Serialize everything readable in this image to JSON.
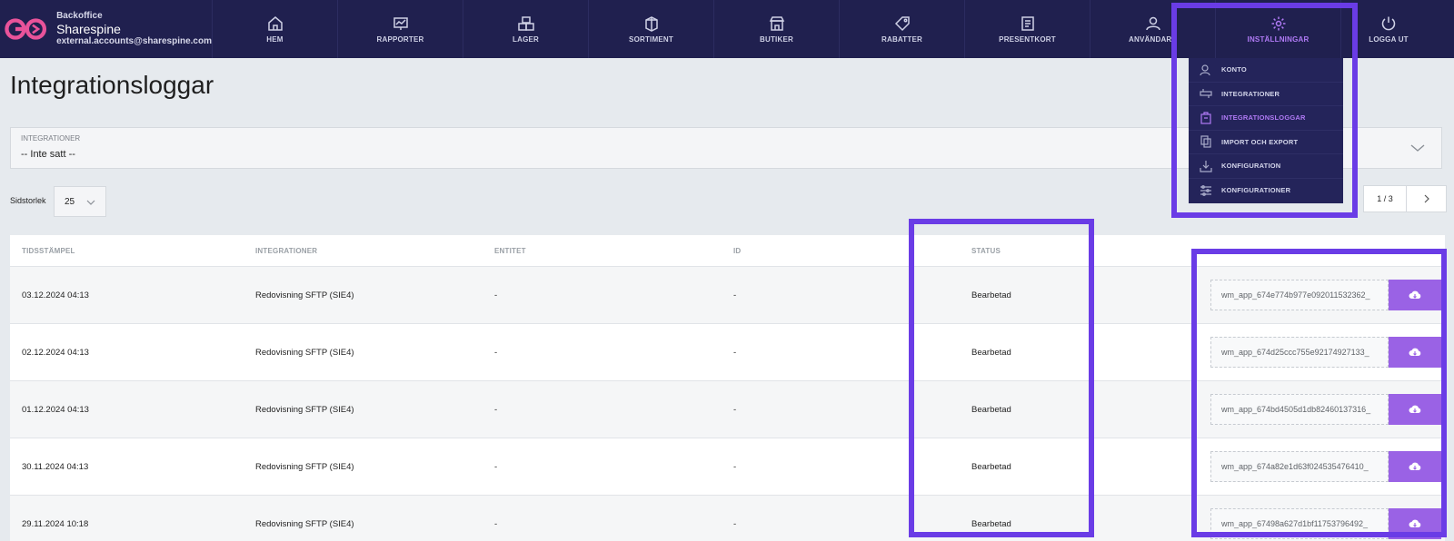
{
  "brand": {
    "small": "Backoffice",
    "name": "Sharespine",
    "email": "external.accounts@sharespine.com"
  },
  "nav": [
    {
      "label": "HEM",
      "icon": "home-icon"
    },
    {
      "label": "RAPPORTER",
      "icon": "chart-icon"
    },
    {
      "label": "LAGER",
      "icon": "boxes-icon"
    },
    {
      "label": "SORTIMENT",
      "icon": "package-icon"
    },
    {
      "label": "BUTIKER",
      "icon": "store-icon"
    },
    {
      "label": "RABATTER",
      "icon": "tag-icon"
    },
    {
      "label": "PRESENTKORT",
      "icon": "giftcard-icon"
    },
    {
      "label": "ANVÄNDARE",
      "icon": "users-icon"
    },
    {
      "label": "INSTÄLLNINGAR",
      "icon": "gear-icon",
      "active": true
    },
    {
      "label": "LOGGA UT",
      "icon": "power-icon"
    }
  ],
  "settings_menu": [
    {
      "label": "KONTO",
      "icon": "account-icon"
    },
    {
      "label": "INTEGRATIONER",
      "icon": "integration-icon"
    },
    {
      "label": "INTEGRATIONSLOGGAR",
      "icon": "log-icon",
      "active": true
    },
    {
      "label": "IMPORT OCH EXPORT",
      "icon": "import-export-icon"
    },
    {
      "label": "KONFIGURATION",
      "icon": "download-tray-icon"
    },
    {
      "label": "KONFIGURATIONER",
      "icon": "sliders-icon"
    }
  ],
  "page": {
    "title": "Integrationsloggar"
  },
  "filter": {
    "label": "INTEGRATIONER",
    "value": "-- Inte satt --"
  },
  "pagesize": {
    "label": "Sidstorlek",
    "value": "25"
  },
  "pager": {
    "text": "1 / 3"
  },
  "table": {
    "headers": [
      "TIDSSTÄMPEL",
      "INTEGRATIONER",
      "ENTITET",
      "ID",
      "STATUS"
    ],
    "rows": [
      {
        "time": "03.12.2024 04:13",
        "integration": "Redovisning SFTP (SIE4)",
        "entity": "-",
        "id": "-",
        "status": "Bearbetad",
        "file": "wm_app_674e774b977e092011532362_"
      },
      {
        "time": "02.12.2024 04:13",
        "integration": "Redovisning SFTP (SIE4)",
        "entity": "-",
        "id": "-",
        "status": "Bearbetad",
        "file": "wm_app_674d25ccc755e92174927133_"
      },
      {
        "time": "01.12.2024 04:13",
        "integration": "Redovisning SFTP (SIE4)",
        "entity": "-",
        "id": "-",
        "status": "Bearbetad",
        "file": "wm_app_674bd4505d1db82460137316_"
      },
      {
        "time": "30.11.2024 04:13",
        "integration": "Redovisning SFTP (SIE4)",
        "entity": "-",
        "id": "-",
        "status": "Bearbetad",
        "file": "wm_app_674a82e1d63f024535476410_"
      },
      {
        "time": "29.11.2024 10:18",
        "integration": "Redovisning SFTP (SIE4)",
        "entity": "-",
        "id": "-",
        "status": "Bearbetad",
        "file": "wm_app_67498a627d1bf11753796492_"
      }
    ]
  },
  "colors": {
    "nav_bg": "#20204f",
    "accent": "#9a62e5",
    "highlight": "#6a3ce6",
    "page_bg": "#e6eaee"
  }
}
